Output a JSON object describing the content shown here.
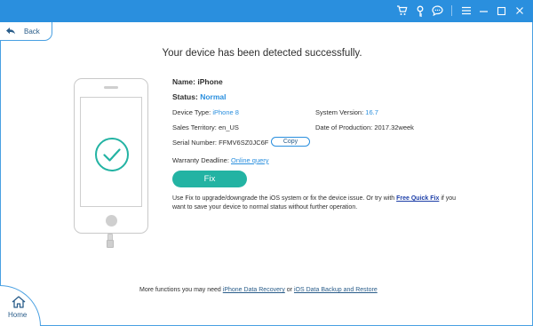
{
  "window": {
    "title_icons": [
      "cart-icon",
      "key-icon",
      "chat-icon",
      "menu-icon",
      "minimize-icon",
      "maximize-icon",
      "close-icon"
    ],
    "accent_color": "#2a8fde",
    "fix_color": "#23b3a3"
  },
  "nav": {
    "back_label": "Back",
    "home_label": "Home"
  },
  "headline": "Your device has been detected successfully.",
  "device": {
    "name_label": "Name:",
    "name_value": "iPhone",
    "status_label": "Status:",
    "status_value": "Normal",
    "type_label": "Device Type:",
    "type_value": "iPhone 8",
    "system_label": "System Version:",
    "system_value": "16.7",
    "territory_label": "Sales Territory:",
    "territory_value": "en_US",
    "production_label": "Date of Production:",
    "production_value": "2017.32week",
    "serial_label": "Serial Number:",
    "serial_value": "FFMV6SZ0JC6F",
    "copy_label": "Copy",
    "warranty_label": "Warranty Deadline:",
    "warranty_link": "Online query"
  },
  "fix": {
    "button_label": "Fix",
    "desc_before": "Use Fix to upgrade/downgrade the iOS system or fix the device issue. Or try with",
    "quick_link": "Free Quick Fix",
    "desc_after": "if you want to save your device to normal status without further operation."
  },
  "footer": {
    "prefix": "More functions you may need",
    "link1": "iPhone Data Recovery",
    "or_text": "or",
    "link2": "iOS Data Backup and Restore"
  }
}
